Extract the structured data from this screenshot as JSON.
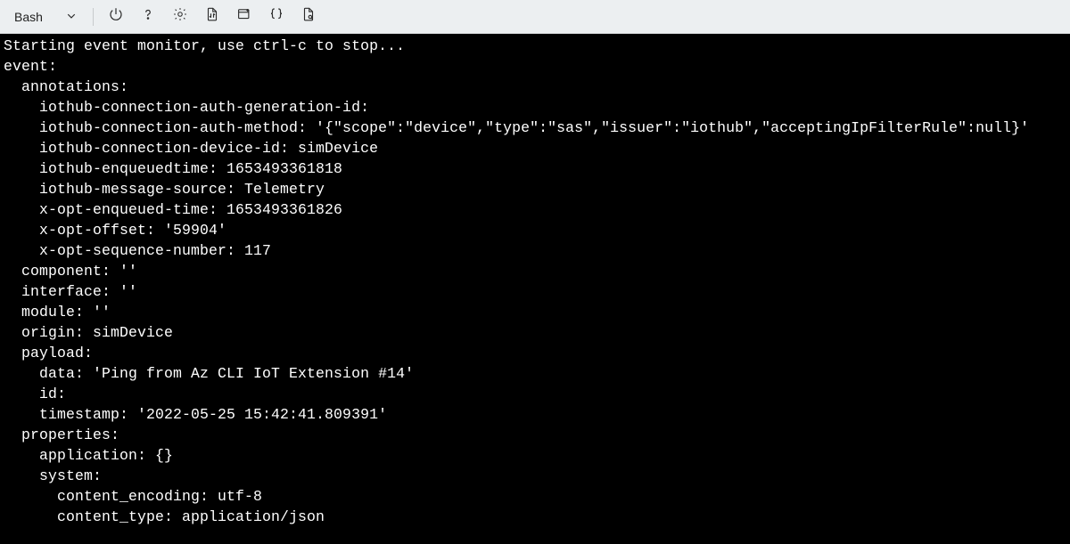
{
  "toolbar": {
    "shell_name": "Bash"
  },
  "terminal": {
    "lines": [
      "Starting event monitor, use ctrl-c to stop...",
      "event:",
      "  annotations:",
      "    iothub-connection-auth-generation-id:",
      "    iothub-connection-auth-method: '{\"scope\":\"device\",\"type\":\"sas\",\"issuer\":\"iothub\",\"acceptingIpFilterRule\":null}'",
      "    iothub-connection-device-id: simDevice",
      "    iothub-enqueuedtime: 1653493361818",
      "    iothub-message-source: Telemetry",
      "    x-opt-enqueued-time: 1653493361826",
      "    x-opt-offset: '59904'",
      "    x-opt-sequence-number: 117",
      "  component: ''",
      "  interface: ''",
      "  module: ''",
      "  origin: simDevice",
      "  payload:",
      "    data: 'Ping from Az CLI IoT Extension #14'",
      "    id:",
      "    timestamp: '2022-05-25 15:42:41.809391'",
      "  properties:",
      "    application: {}",
      "    system:",
      "      content_encoding: utf-8",
      "      content_type: application/json"
    ]
  }
}
